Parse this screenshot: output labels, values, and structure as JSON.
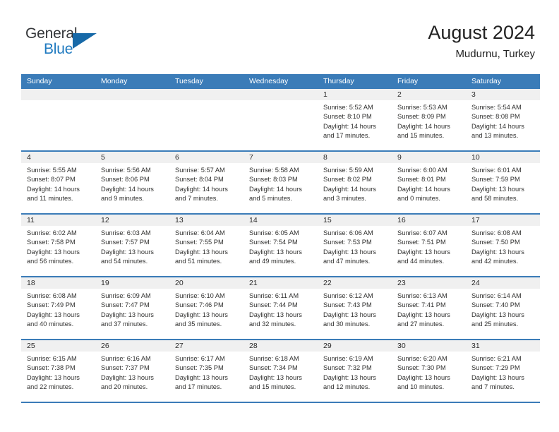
{
  "logo": {
    "word_top": "General",
    "word_bottom": "Blue",
    "triangle_icon": "blue-triangle-icon",
    "accent_color": "#1769a8"
  },
  "header": {
    "title": "August 2024",
    "subtitle": "Mudurnu, Turkey"
  },
  "colors": {
    "header_blue": "#3b7cb8",
    "daynum_band": "#f0f0f0",
    "text": "#30302f"
  },
  "calendar": {
    "weekday_headers": [
      "Sunday",
      "Monday",
      "Tuesday",
      "Wednesday",
      "Thursday",
      "Friday",
      "Saturday"
    ],
    "labels": {
      "sunrise": "Sunrise:",
      "sunset": "Sunset:",
      "daylight": "Daylight:"
    },
    "weeks": [
      [
        {
          "day": "",
          "empty": true
        },
        {
          "day": "",
          "empty": true
        },
        {
          "day": "",
          "empty": true
        },
        {
          "day": "",
          "empty": true
        },
        {
          "day": "1",
          "sunrise": "Sunrise: 5:52 AM",
          "sunset": "Sunset: 8:10 PM",
          "daylight": "Daylight: 14 hours and 17 minutes."
        },
        {
          "day": "2",
          "sunrise": "Sunrise: 5:53 AM",
          "sunset": "Sunset: 8:09 PM",
          "daylight": "Daylight: 14 hours and 15 minutes."
        },
        {
          "day": "3",
          "sunrise": "Sunrise: 5:54 AM",
          "sunset": "Sunset: 8:08 PM",
          "daylight": "Daylight: 14 hours and 13 minutes."
        }
      ],
      [
        {
          "day": "4",
          "sunrise": "Sunrise: 5:55 AM",
          "sunset": "Sunset: 8:07 PM",
          "daylight": "Daylight: 14 hours and 11 minutes."
        },
        {
          "day": "5",
          "sunrise": "Sunrise: 5:56 AM",
          "sunset": "Sunset: 8:06 PM",
          "daylight": "Daylight: 14 hours and 9 minutes."
        },
        {
          "day": "6",
          "sunrise": "Sunrise: 5:57 AM",
          "sunset": "Sunset: 8:04 PM",
          "daylight": "Daylight: 14 hours and 7 minutes."
        },
        {
          "day": "7",
          "sunrise": "Sunrise: 5:58 AM",
          "sunset": "Sunset: 8:03 PM",
          "daylight": "Daylight: 14 hours and 5 minutes."
        },
        {
          "day": "8",
          "sunrise": "Sunrise: 5:59 AM",
          "sunset": "Sunset: 8:02 PM",
          "daylight": "Daylight: 14 hours and 3 minutes."
        },
        {
          "day": "9",
          "sunrise": "Sunrise: 6:00 AM",
          "sunset": "Sunset: 8:01 PM",
          "daylight": "Daylight: 14 hours and 0 minutes."
        },
        {
          "day": "10",
          "sunrise": "Sunrise: 6:01 AM",
          "sunset": "Sunset: 7:59 PM",
          "daylight": "Daylight: 13 hours and 58 minutes."
        }
      ],
      [
        {
          "day": "11",
          "sunrise": "Sunrise: 6:02 AM",
          "sunset": "Sunset: 7:58 PM",
          "daylight": "Daylight: 13 hours and 56 minutes."
        },
        {
          "day": "12",
          "sunrise": "Sunrise: 6:03 AM",
          "sunset": "Sunset: 7:57 PM",
          "daylight": "Daylight: 13 hours and 54 minutes."
        },
        {
          "day": "13",
          "sunrise": "Sunrise: 6:04 AM",
          "sunset": "Sunset: 7:55 PM",
          "daylight": "Daylight: 13 hours and 51 minutes."
        },
        {
          "day": "14",
          "sunrise": "Sunrise: 6:05 AM",
          "sunset": "Sunset: 7:54 PM",
          "daylight": "Daylight: 13 hours and 49 minutes."
        },
        {
          "day": "15",
          "sunrise": "Sunrise: 6:06 AM",
          "sunset": "Sunset: 7:53 PM",
          "daylight": "Daylight: 13 hours and 47 minutes."
        },
        {
          "day": "16",
          "sunrise": "Sunrise: 6:07 AM",
          "sunset": "Sunset: 7:51 PM",
          "daylight": "Daylight: 13 hours and 44 minutes."
        },
        {
          "day": "17",
          "sunrise": "Sunrise: 6:08 AM",
          "sunset": "Sunset: 7:50 PM",
          "daylight": "Daylight: 13 hours and 42 minutes."
        }
      ],
      [
        {
          "day": "18",
          "sunrise": "Sunrise: 6:08 AM",
          "sunset": "Sunset: 7:49 PM",
          "daylight": "Daylight: 13 hours and 40 minutes."
        },
        {
          "day": "19",
          "sunrise": "Sunrise: 6:09 AM",
          "sunset": "Sunset: 7:47 PM",
          "daylight": "Daylight: 13 hours and 37 minutes."
        },
        {
          "day": "20",
          "sunrise": "Sunrise: 6:10 AM",
          "sunset": "Sunset: 7:46 PM",
          "daylight": "Daylight: 13 hours and 35 minutes."
        },
        {
          "day": "21",
          "sunrise": "Sunrise: 6:11 AM",
          "sunset": "Sunset: 7:44 PM",
          "daylight": "Daylight: 13 hours and 32 minutes."
        },
        {
          "day": "22",
          "sunrise": "Sunrise: 6:12 AM",
          "sunset": "Sunset: 7:43 PM",
          "daylight": "Daylight: 13 hours and 30 minutes."
        },
        {
          "day": "23",
          "sunrise": "Sunrise: 6:13 AM",
          "sunset": "Sunset: 7:41 PM",
          "daylight": "Daylight: 13 hours and 27 minutes."
        },
        {
          "day": "24",
          "sunrise": "Sunrise: 6:14 AM",
          "sunset": "Sunset: 7:40 PM",
          "daylight": "Daylight: 13 hours and 25 minutes."
        }
      ],
      [
        {
          "day": "25",
          "sunrise": "Sunrise: 6:15 AM",
          "sunset": "Sunset: 7:38 PM",
          "daylight": "Daylight: 13 hours and 22 minutes."
        },
        {
          "day": "26",
          "sunrise": "Sunrise: 6:16 AM",
          "sunset": "Sunset: 7:37 PM",
          "daylight": "Daylight: 13 hours and 20 minutes."
        },
        {
          "day": "27",
          "sunrise": "Sunrise: 6:17 AM",
          "sunset": "Sunset: 7:35 PM",
          "daylight": "Daylight: 13 hours and 17 minutes."
        },
        {
          "day": "28",
          "sunrise": "Sunrise: 6:18 AM",
          "sunset": "Sunset: 7:34 PM",
          "daylight": "Daylight: 13 hours and 15 minutes."
        },
        {
          "day": "29",
          "sunrise": "Sunrise: 6:19 AM",
          "sunset": "Sunset: 7:32 PM",
          "daylight": "Daylight: 13 hours and 12 minutes."
        },
        {
          "day": "30",
          "sunrise": "Sunrise: 6:20 AM",
          "sunset": "Sunset: 7:30 PM",
          "daylight": "Daylight: 13 hours and 10 minutes."
        },
        {
          "day": "31",
          "sunrise": "Sunrise: 6:21 AM",
          "sunset": "Sunset: 7:29 PM",
          "daylight": "Daylight: 13 hours and 7 minutes."
        }
      ]
    ]
  }
}
